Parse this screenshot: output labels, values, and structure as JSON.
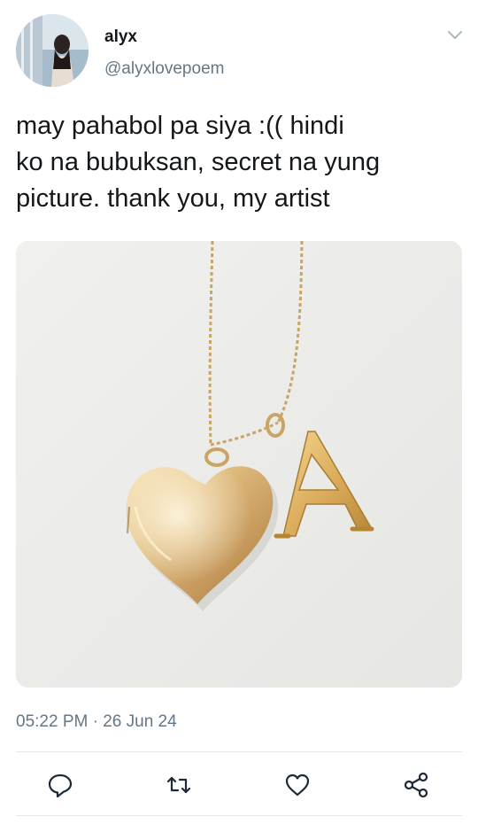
{
  "tweet": {
    "author": {
      "name": "alyx",
      "handle": "@alyxlovepoem"
    },
    "text": "may pahabol pa siya :(( hindi\nko na bubuksan, secret na yung\npicture. thank you, my artist",
    "timestamp": "05:22 PM · 26 Jun 24",
    "media": {
      "description_icon": "photo",
      "pendant_letter": "A"
    },
    "actions": [
      "reply-icon",
      "retweet-icon",
      "like-icon",
      "share-icon"
    ]
  },
  "colors": {
    "text": "#14171a",
    "muted": "#657786",
    "divider": "#e1e8ed",
    "icon": "#1c2938"
  }
}
